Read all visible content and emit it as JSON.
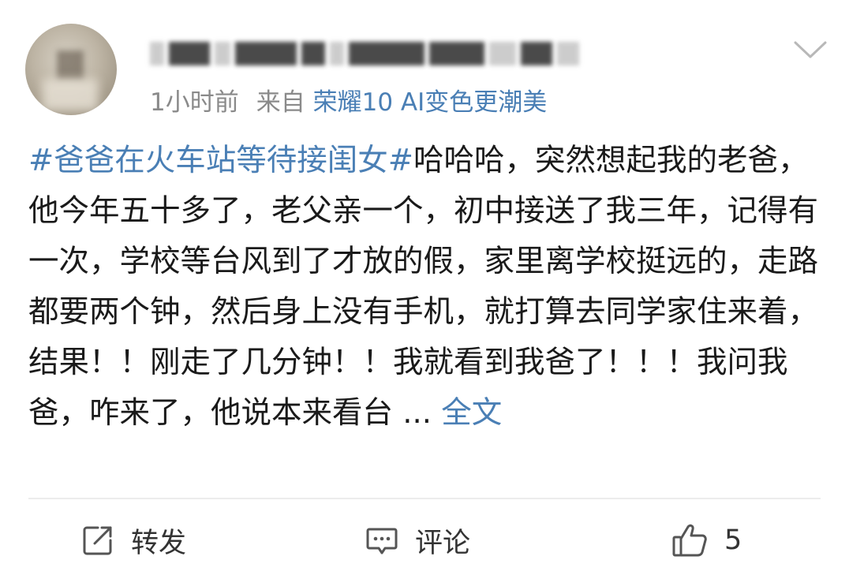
{
  "post": {
    "time": "1小时前",
    "source_prefix": "来自",
    "device": "荣耀10 AI变色更潮美",
    "topic": "#爸爸在火车站等待接闺女#",
    "body": "哈哈哈，突然想起我的老爸，他今年五十多了，老父亲一个，初中接送了我三年，记得有一次，学校等台风到了才放的假，家里离学校挺远的，走路都要两个钟，然后身上没有手机，就打算去同学家住来着，结果！！刚走了几分钟！！我就看到我爸了！！！我问我爸，咋来了，他说本来看台",
    "ellipsis": " ... ",
    "more_label": "全文"
  },
  "actions": {
    "repost_label": "转发",
    "comment_label": "评论",
    "like_count": "5"
  },
  "icons": {
    "menu": "chevron-down-icon",
    "repost": "share-icon",
    "comment": "comment-icon",
    "like": "thumbs-up-icon"
  },
  "colors": {
    "link": "#4a7fb5",
    "meta": "#8a8a8a",
    "text": "#1a1a1a"
  }
}
